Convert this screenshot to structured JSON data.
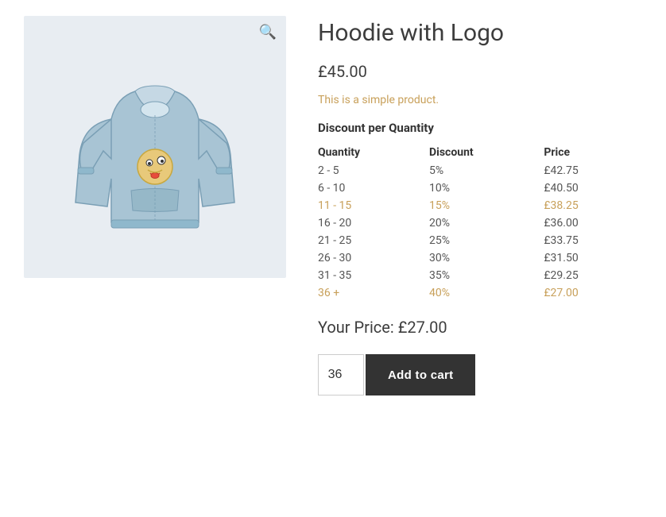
{
  "product": {
    "title": "Hoodie with Logo",
    "price": "£45.00",
    "description": "This is a simple product.",
    "discount_section_title": "Discount per Quantity",
    "table_headers": {
      "quantity": "Quantity",
      "discount": "Discount",
      "price": "Price"
    },
    "discount_rows": [
      {
        "quantity": "2 - 5",
        "discount": "5%",
        "price": "£42.75",
        "highlight": false
      },
      {
        "quantity": "6 - 10",
        "discount": "10%",
        "price": "£40.50",
        "highlight": false
      },
      {
        "quantity": "11 - 15",
        "discount": "15%",
        "price": "£38.25",
        "highlight": true
      },
      {
        "quantity": "16 - 20",
        "discount": "20%",
        "price": "£36.00",
        "highlight": false
      },
      {
        "quantity": "21 - 25",
        "discount": "25%",
        "price": "£33.75",
        "highlight": false
      },
      {
        "quantity": "26 - 30",
        "discount": "30%",
        "price": "£31.50",
        "highlight": false
      },
      {
        "quantity": "31 - 35",
        "discount": "35%",
        "price": "£29.25",
        "highlight": false
      },
      {
        "quantity": "36 +",
        "discount": "40%",
        "price": "£27.00",
        "highlight": true
      }
    ],
    "your_price_label": "Your Price:",
    "your_price_value": "£27.00",
    "quantity_value": "36",
    "add_to_cart_label": "Add to cart"
  }
}
